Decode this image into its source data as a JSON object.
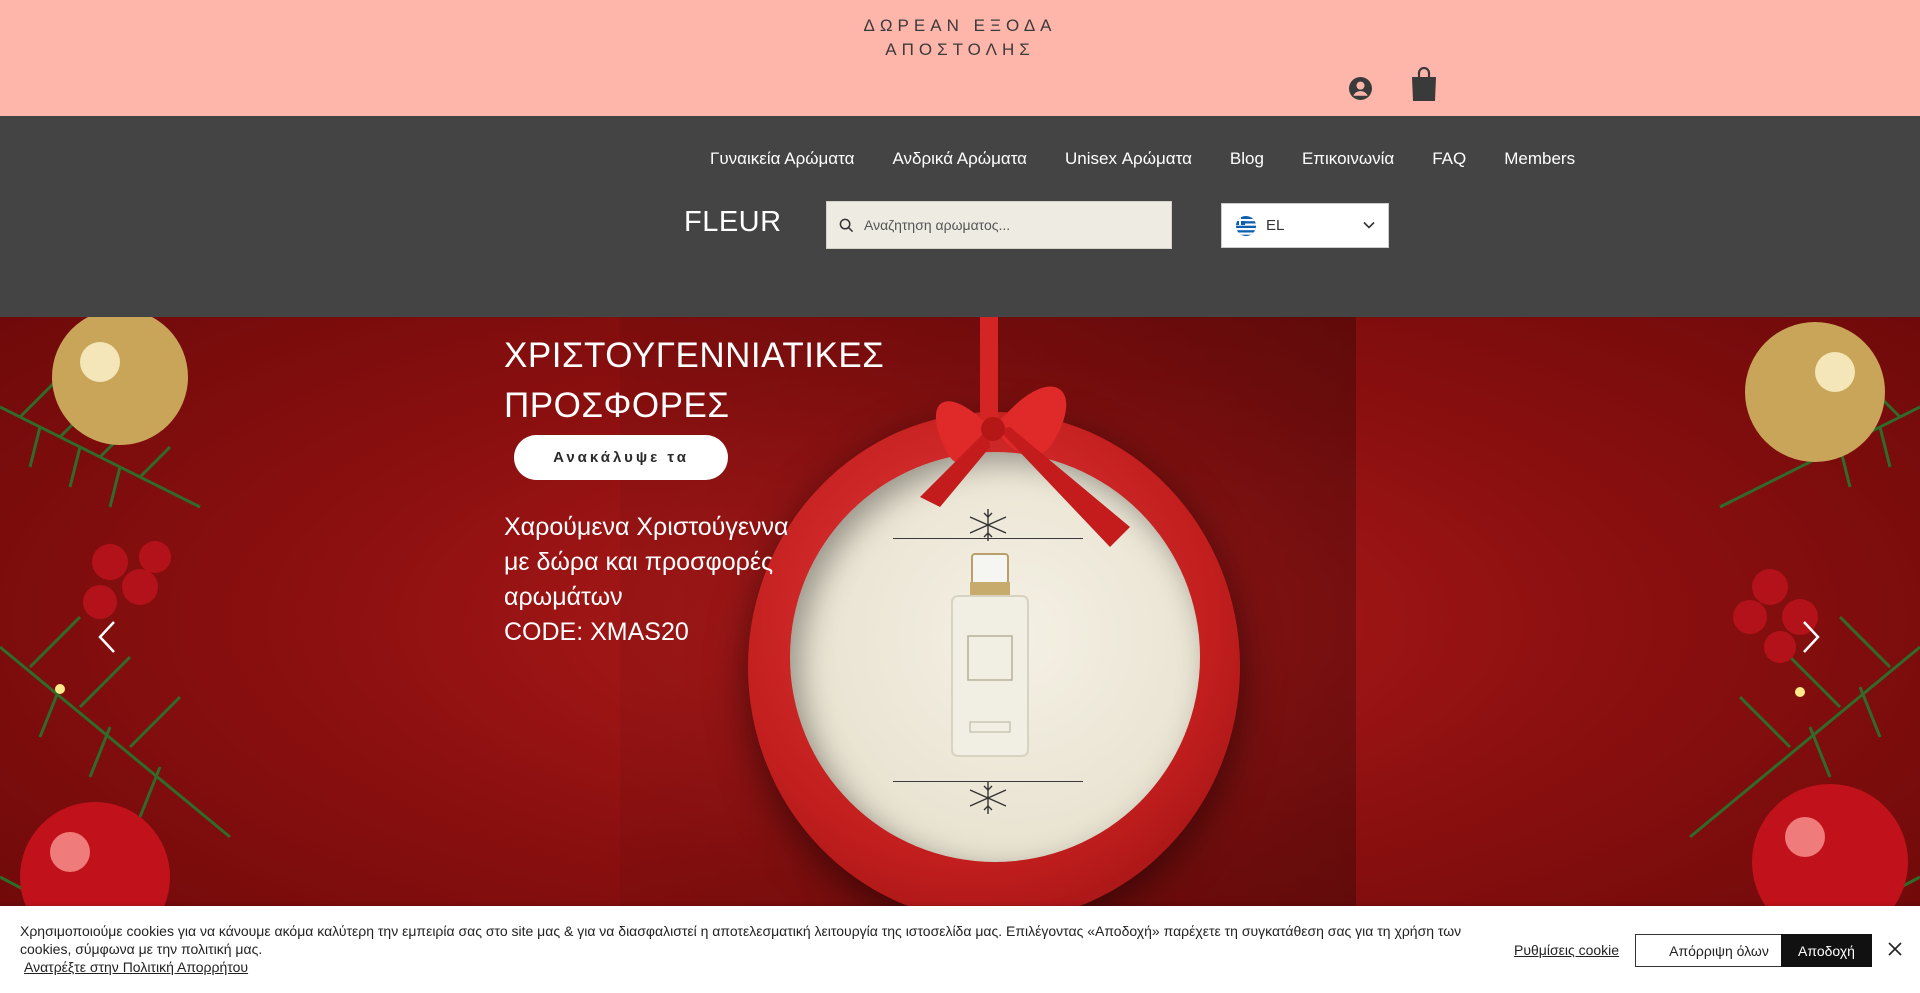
{
  "topbar": {
    "promo_line1": "ΔΩΡΕΑΝ ΕΞΟΔΑ",
    "promo_line2": "ΑΠΟΣΤΟΛΗΣ",
    "account_icon": "account-icon",
    "cart_icon": "shopping-bag-icon"
  },
  "nav": {
    "items": [
      {
        "label": "Γυναικεία Αρώματα"
      },
      {
        "label": "Ανδρικά Αρώματα"
      },
      {
        "label": "Unisex Αρώματα"
      },
      {
        "label": "Blog"
      },
      {
        "label": "Επικοινωνία"
      },
      {
        "label": "FAQ"
      },
      {
        "label": "Members"
      }
    ],
    "brand": "FLEUR",
    "search_placeholder": "Αναζητηση αρωματος...",
    "language": "EL"
  },
  "hero": {
    "title": "ΧΡΙΣΤΟΥΓΕΝΝΙΑΤΙΚΕΣ ΠΡΟΣΦΟΡΕΣ",
    "cta": "Ανακάλυψε τα",
    "text_line1": "Χαρούμενα Χριστούγεννα",
    "text_line2": "με δώρα και προσφορές",
    "text_line3": "αρωμάτων",
    "text_line4": "CODE: XMAS20"
  },
  "cookie": {
    "text": "Χρησιμοποιούμε cookies για να κάνουμε ακόμα καλύτερη την εμπειρία σας στο site μας & για να διασφαλιστεί η αποτελεσματική λειτουργία της ιστοσελίδα μας. Επιλέγοντας «Αποδοχή» παρέχετε τη συγκατάθεση σας για τη χρήση των cookies, σύμφωνα με την πολιτική μας.",
    "policy_link": "Ανατρέξτε στην Πολιτική Απορρήτου",
    "settings": "Ρυθμίσεις cookie",
    "reject": "Απόρριψη όλων",
    "accept": "Αποδοχή"
  },
  "colors": {
    "topbar_bg": "#ffb6aa",
    "nav_bg": "#444444",
    "hero_red": "#8a0f0f"
  }
}
